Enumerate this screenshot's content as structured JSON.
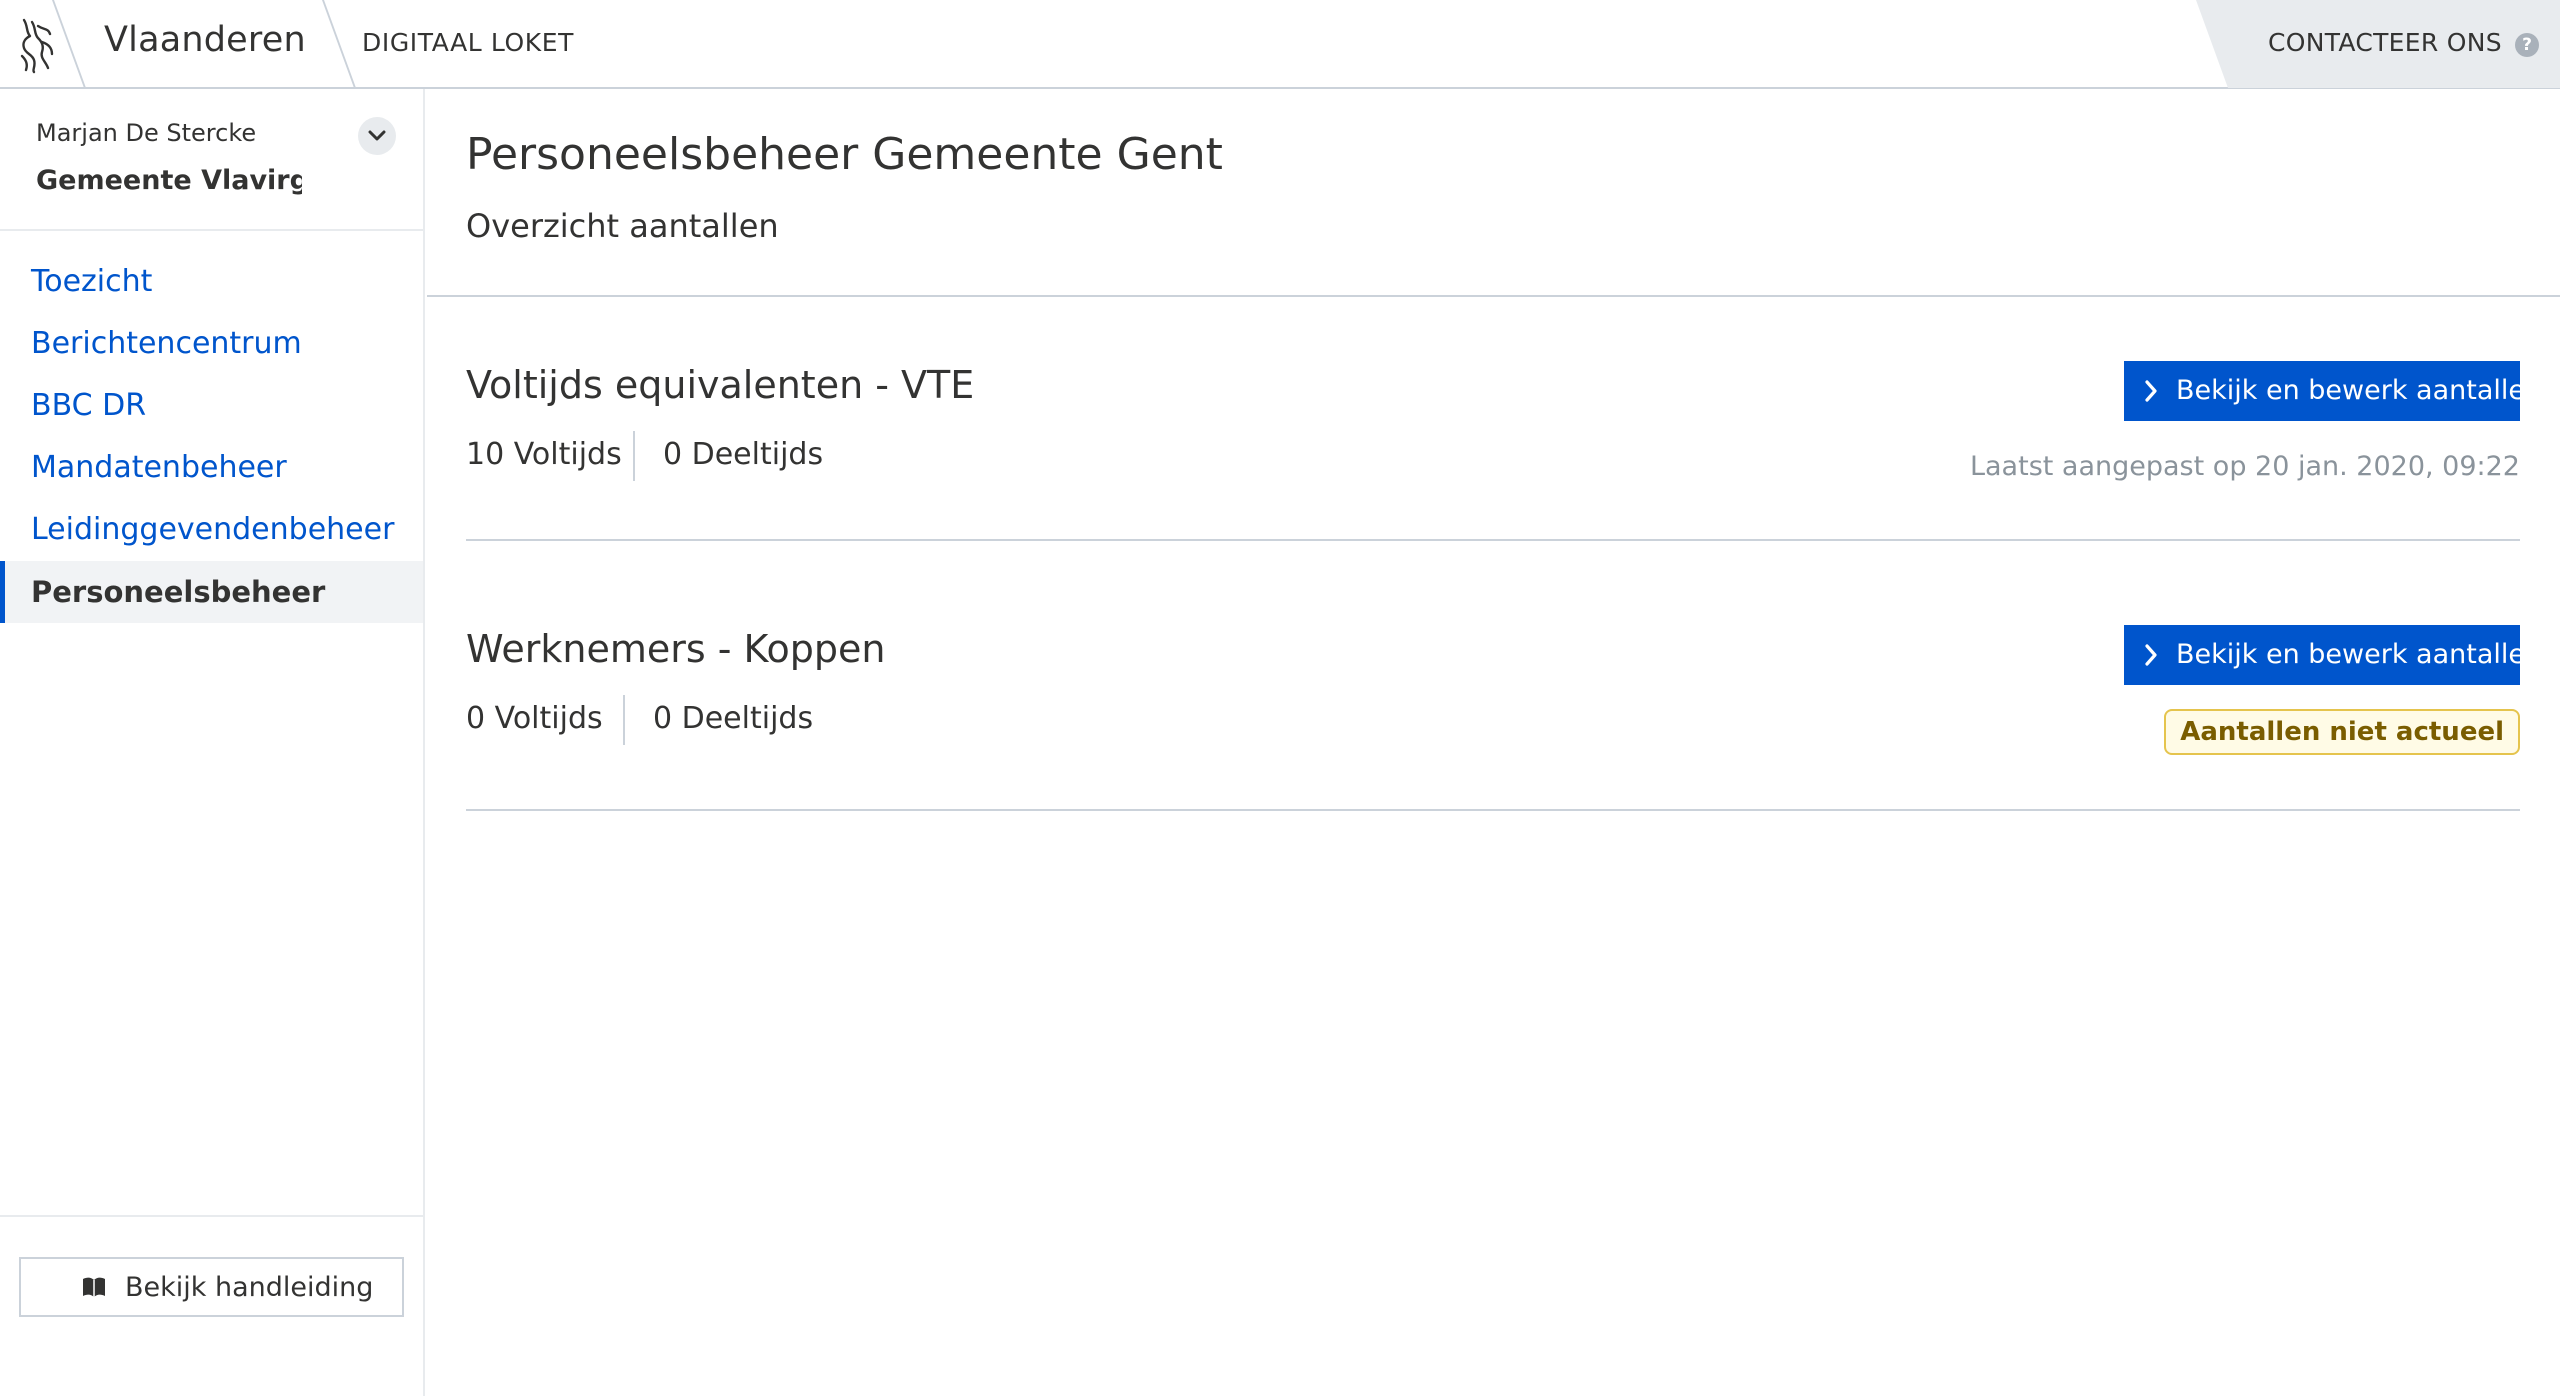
{
  "header": {
    "brand": "Vlaanderen",
    "app_name": "DIGITAAL LOKET",
    "contact_label": "CONTACTEER ONS",
    "help_glyph": "?"
  },
  "sidebar": {
    "user_name": "Marjan De Stercke",
    "organization": "Gemeente Vlavirgem",
    "items": [
      {
        "label": "Toezicht"
      },
      {
        "label": "Berichtencentrum"
      },
      {
        "label": "BBC DR"
      },
      {
        "label": "Mandatenbeheer"
      },
      {
        "label": "Leidinggevendenbeheer"
      },
      {
        "label": "Personeelsbeheer",
        "active": true
      }
    ],
    "manual_button": "Bekijk handleiding"
  },
  "main": {
    "title": "Personeelsbeheer Gemeente Gent",
    "subtitle": "Overzicht aantallen",
    "sections": [
      {
        "title": "Voltijds equivalenten - VTE",
        "fulltime": "10 Voltijds",
        "parttime": "0 Deeltijds",
        "button": "Bekijk en bewerk aantallen",
        "last_modified": "Laatst aangepast op 20 jan. 2020, 09:22"
      },
      {
        "title": "Werknemers - Koppen",
        "fulltime": "0 Voltijds",
        "parttime": "0 Deeltijds",
        "button": "Bekijk en bewerk aantallen",
        "status_badge": "Aantallen niet actueel"
      }
    ]
  },
  "icons": {
    "logo": "flemish-lion-icon",
    "toggle": "chevron-down-icon",
    "manual": "book-icon",
    "button": "chevron-right-icon"
  },
  "colors": {
    "accent": "#0055cc",
    "text": "#333332",
    "muted": "#8a939b",
    "warning_border": "#e5c44d",
    "warning_text": "#7a5d00"
  }
}
